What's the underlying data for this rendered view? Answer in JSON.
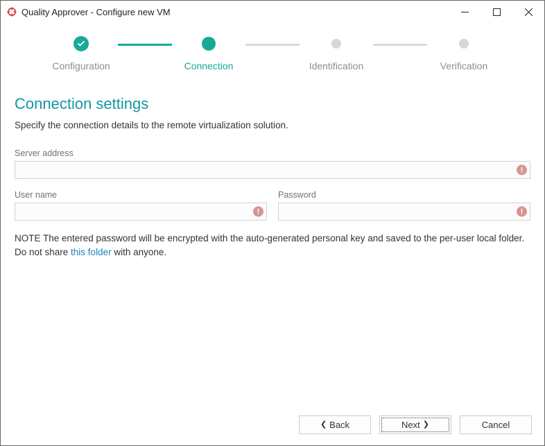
{
  "window": {
    "title": "Quality Approver - Configure new VM"
  },
  "stepper": {
    "steps": [
      {
        "label": "Configuration",
        "state": "done"
      },
      {
        "label": "Connection",
        "state": "current"
      },
      {
        "label": "Identification",
        "state": "pending"
      },
      {
        "label": "Verification",
        "state": "pending"
      }
    ]
  },
  "page": {
    "heading": "Connection settings",
    "subheading": "Specify the connection details to the remote virtualization solution."
  },
  "fields": {
    "server_address": {
      "label": "Server address",
      "value": ""
    },
    "user_name": {
      "label": "User name",
      "value": ""
    },
    "password": {
      "label": "Password",
      "value": ""
    }
  },
  "note": {
    "prefix": "NOTE The entered password will be encrypted with the auto-generated personal key and saved to the per-user local folder. Do not share ",
    "link_text": "this folder",
    "suffix": " with anyone."
  },
  "buttons": {
    "back": "Back",
    "next": "Next",
    "cancel": "Cancel"
  }
}
